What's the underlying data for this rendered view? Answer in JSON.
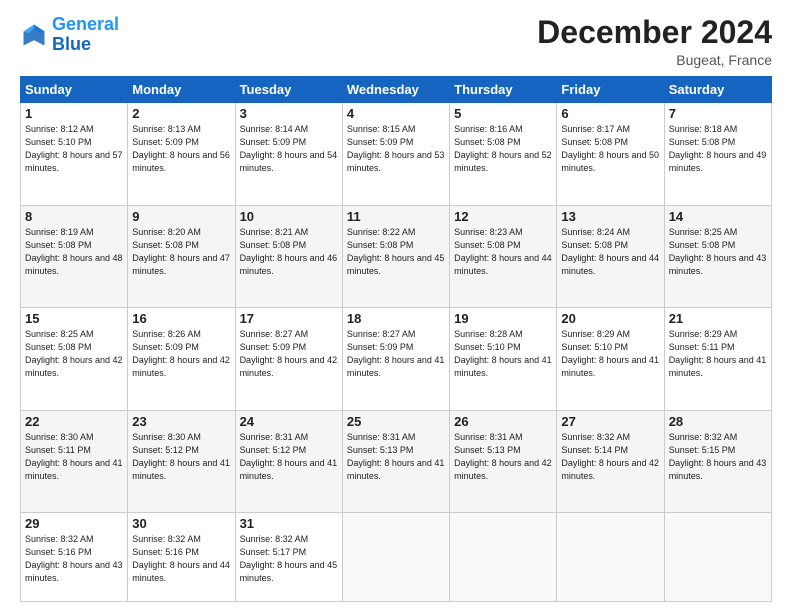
{
  "header": {
    "logo_line1": "General",
    "logo_line2": "Blue",
    "month": "December 2024",
    "location": "Bugeat, France"
  },
  "days_of_week": [
    "Sunday",
    "Monday",
    "Tuesday",
    "Wednesday",
    "Thursday",
    "Friday",
    "Saturday"
  ],
  "weeks": [
    [
      {
        "num": "1",
        "sunrise": "8:12 AM",
        "sunset": "5:10 PM",
        "daylight": "8 hours and 57 minutes."
      },
      {
        "num": "2",
        "sunrise": "8:13 AM",
        "sunset": "5:09 PM",
        "daylight": "8 hours and 56 minutes."
      },
      {
        "num": "3",
        "sunrise": "8:14 AM",
        "sunset": "5:09 PM",
        "daylight": "8 hours and 54 minutes."
      },
      {
        "num": "4",
        "sunrise": "8:15 AM",
        "sunset": "5:09 PM",
        "daylight": "8 hours and 53 minutes."
      },
      {
        "num": "5",
        "sunrise": "8:16 AM",
        "sunset": "5:08 PM",
        "daylight": "8 hours and 52 minutes."
      },
      {
        "num": "6",
        "sunrise": "8:17 AM",
        "sunset": "5:08 PM",
        "daylight": "8 hours and 50 minutes."
      },
      {
        "num": "7",
        "sunrise": "8:18 AM",
        "sunset": "5:08 PM",
        "daylight": "8 hours and 49 minutes."
      }
    ],
    [
      {
        "num": "8",
        "sunrise": "8:19 AM",
        "sunset": "5:08 PM",
        "daylight": "8 hours and 48 minutes."
      },
      {
        "num": "9",
        "sunrise": "8:20 AM",
        "sunset": "5:08 PM",
        "daylight": "8 hours and 47 minutes."
      },
      {
        "num": "10",
        "sunrise": "8:21 AM",
        "sunset": "5:08 PM",
        "daylight": "8 hours and 46 minutes."
      },
      {
        "num": "11",
        "sunrise": "8:22 AM",
        "sunset": "5:08 PM",
        "daylight": "8 hours and 45 minutes."
      },
      {
        "num": "12",
        "sunrise": "8:23 AM",
        "sunset": "5:08 PM",
        "daylight": "8 hours and 44 minutes."
      },
      {
        "num": "13",
        "sunrise": "8:24 AM",
        "sunset": "5:08 PM",
        "daylight": "8 hours and 44 minutes."
      },
      {
        "num": "14",
        "sunrise": "8:25 AM",
        "sunset": "5:08 PM",
        "daylight": "8 hours and 43 minutes."
      }
    ],
    [
      {
        "num": "15",
        "sunrise": "8:25 AM",
        "sunset": "5:08 PM",
        "daylight": "8 hours and 42 minutes."
      },
      {
        "num": "16",
        "sunrise": "8:26 AM",
        "sunset": "5:09 PM",
        "daylight": "8 hours and 42 minutes."
      },
      {
        "num": "17",
        "sunrise": "8:27 AM",
        "sunset": "5:09 PM",
        "daylight": "8 hours and 42 minutes."
      },
      {
        "num": "18",
        "sunrise": "8:27 AM",
        "sunset": "5:09 PM",
        "daylight": "8 hours and 41 minutes."
      },
      {
        "num": "19",
        "sunrise": "8:28 AM",
        "sunset": "5:10 PM",
        "daylight": "8 hours and 41 minutes."
      },
      {
        "num": "20",
        "sunrise": "8:29 AM",
        "sunset": "5:10 PM",
        "daylight": "8 hours and 41 minutes."
      },
      {
        "num": "21",
        "sunrise": "8:29 AM",
        "sunset": "5:11 PM",
        "daylight": "8 hours and 41 minutes."
      }
    ],
    [
      {
        "num": "22",
        "sunrise": "8:30 AM",
        "sunset": "5:11 PM",
        "daylight": "8 hours and 41 minutes."
      },
      {
        "num": "23",
        "sunrise": "8:30 AM",
        "sunset": "5:12 PM",
        "daylight": "8 hours and 41 minutes."
      },
      {
        "num": "24",
        "sunrise": "8:31 AM",
        "sunset": "5:12 PM",
        "daylight": "8 hours and 41 minutes."
      },
      {
        "num": "25",
        "sunrise": "8:31 AM",
        "sunset": "5:13 PM",
        "daylight": "8 hours and 41 minutes."
      },
      {
        "num": "26",
        "sunrise": "8:31 AM",
        "sunset": "5:13 PM",
        "daylight": "8 hours and 42 minutes."
      },
      {
        "num": "27",
        "sunrise": "8:32 AM",
        "sunset": "5:14 PM",
        "daylight": "8 hours and 42 minutes."
      },
      {
        "num": "28",
        "sunrise": "8:32 AM",
        "sunset": "5:15 PM",
        "daylight": "8 hours and 43 minutes."
      }
    ],
    [
      {
        "num": "29",
        "sunrise": "8:32 AM",
        "sunset": "5:16 PM",
        "daylight": "8 hours and 43 minutes."
      },
      {
        "num": "30",
        "sunrise": "8:32 AM",
        "sunset": "5:16 PM",
        "daylight": "8 hours and 44 minutes."
      },
      {
        "num": "31",
        "sunrise": "8:32 AM",
        "sunset": "5:17 PM",
        "daylight": "8 hours and 45 minutes."
      },
      null,
      null,
      null,
      null
    ]
  ]
}
